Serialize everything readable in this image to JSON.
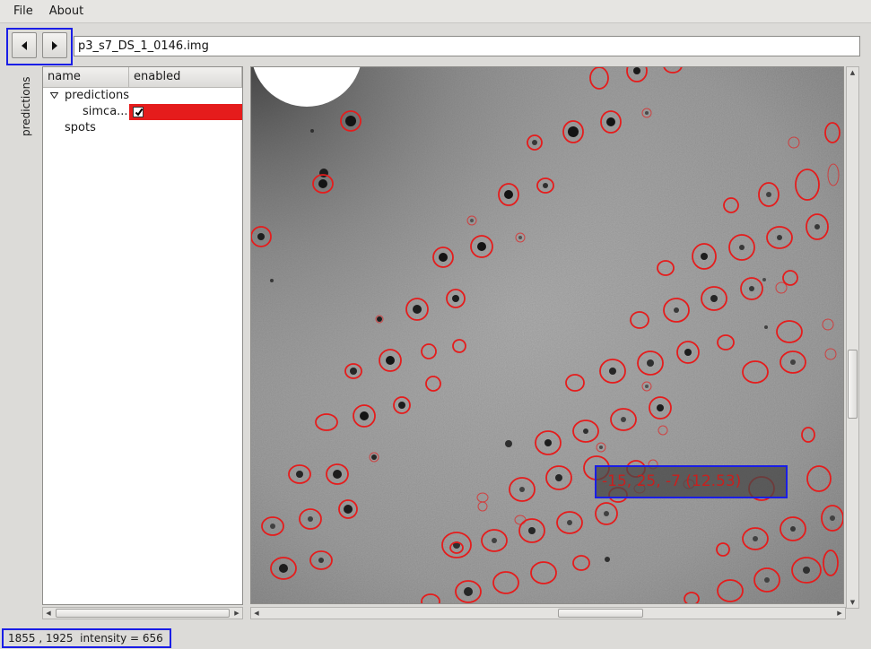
{
  "menu": {
    "file": "File",
    "about": "About"
  },
  "nav": {
    "prev_icon": "triangle-left-icon",
    "next_icon": "triangle-right-icon"
  },
  "file_path": "p3_s7_DS_1_0146.img",
  "side_tab": {
    "label": "predictions"
  },
  "tree": {
    "columns": {
      "name": "name",
      "enabled": "enabled"
    },
    "root": {
      "label": "predictions",
      "expanded": true
    },
    "child": {
      "label": "simca...",
      "enabled": true,
      "highlight_color": "#e51c1c"
    },
    "spots": {
      "label": "spots"
    }
  },
  "viewer": {
    "hkl_label": "-15, 25, -7  (12.53)"
  },
  "status": {
    "coords": "1855 , 1925",
    "intensity": "intensity = 656"
  },
  "colors": {
    "accent_frame": "#1a1ee6",
    "prediction_circle": "#e51c1c"
  }
}
